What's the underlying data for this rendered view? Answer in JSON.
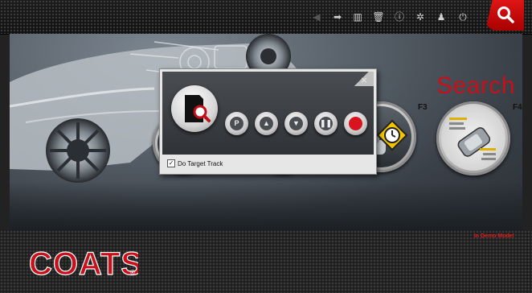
{
  "toolbar": {
    "buttons": [
      {
        "name": "back-arrow-icon",
        "glyph": "◀",
        "enabled": false
      },
      {
        "name": "forward-arrow-icon",
        "glyph": "➡",
        "enabled": true
      },
      {
        "name": "manual-book-icon",
        "glyph": "▥",
        "enabled": true
      },
      {
        "name": "trash-icon",
        "glyph": "🗑",
        "enabled": true
      },
      {
        "name": "info-icon",
        "glyph": "ⓘ",
        "enabled": true
      },
      {
        "name": "settings-gear-icon",
        "glyph": "✲",
        "enabled": true
      },
      {
        "name": "user-icon",
        "glyph": "♟",
        "enabled": true
      },
      {
        "name": "power-icon",
        "glyph": "⏻",
        "enabled": true
      }
    ],
    "search_icon": "magnifier-icon",
    "search_color": "#d01010"
  },
  "main": {
    "title": "Search",
    "title_color": "#c8101b",
    "function_keys": [
      "F3",
      "F4"
    ]
  },
  "dialog": {
    "close_glyph": "×",
    "controls": [
      {
        "name": "park-button",
        "label": "P"
      },
      {
        "name": "up-arrow-button",
        "label": "▲"
      },
      {
        "name": "down-arrow-button",
        "label": "▼"
      },
      {
        "name": "pause-button",
        "label": "❚❚"
      },
      {
        "name": "record-button",
        "label": ""
      }
    ],
    "checkbox": {
      "checked": true,
      "mark": "✓",
      "label": "Do Target Track"
    }
  },
  "footer": {
    "demo_text": "In Demo Mode!",
    "brand": "COATS",
    "brand_mark": "®",
    "brand_color": "#c8101b"
  }
}
